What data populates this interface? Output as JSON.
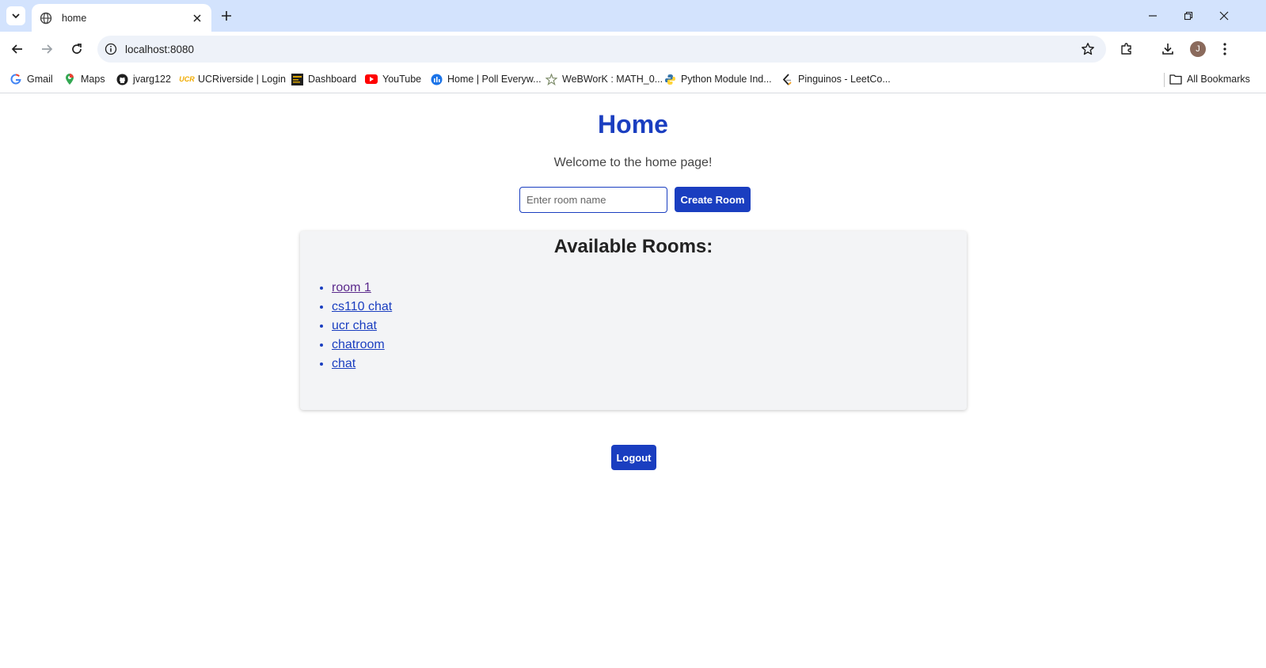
{
  "browser": {
    "tab": {
      "title": "home"
    },
    "url": "localhost:8080",
    "avatar_initial": "J",
    "bookmarks": [
      {
        "label": "Gmail",
        "icon": "gmail-icon"
      },
      {
        "label": "Maps",
        "icon": "maps-icon"
      },
      {
        "label": "jvarg122",
        "icon": "github-icon"
      },
      {
        "label": "UCRiverside | Login",
        "icon": "ucr-icon"
      },
      {
        "label": "Dashboard",
        "icon": "dashboard-icon"
      },
      {
        "label": "YouTube",
        "icon": "youtube-icon"
      },
      {
        "label": "Home | Poll Everyw...",
        "icon": "poll-everywhere-icon"
      },
      {
        "label": "WeBWorK : MATH_0...",
        "icon": "webwork-icon"
      },
      {
        "label": "Python Module Ind...",
        "icon": "python-icon"
      },
      {
        "label": "Pinguinos - LeetCo...",
        "icon": "leetcode-icon"
      }
    ],
    "all_bookmarks_label": "All Bookmarks"
  },
  "page": {
    "title": "Home",
    "welcome": "Welcome to the home page!",
    "room_input_placeholder": "Enter room name",
    "create_button": "Create Room",
    "rooms_heading": "Available Rooms:",
    "rooms": [
      {
        "name": "room 1",
        "visited": true
      },
      {
        "name": "cs110 chat",
        "visited": false
      },
      {
        "name": "ucr chat",
        "visited": false
      },
      {
        "name": "chatroom",
        "visited": false
      },
      {
        "name": "chat",
        "visited": false
      }
    ],
    "logout_button": "Logout"
  },
  "colors": {
    "accent": "#1a3ec0",
    "tabstrip": "#d3e3fd",
    "panel": "#f3f4f6",
    "visited_link": "#5b2a8c"
  }
}
